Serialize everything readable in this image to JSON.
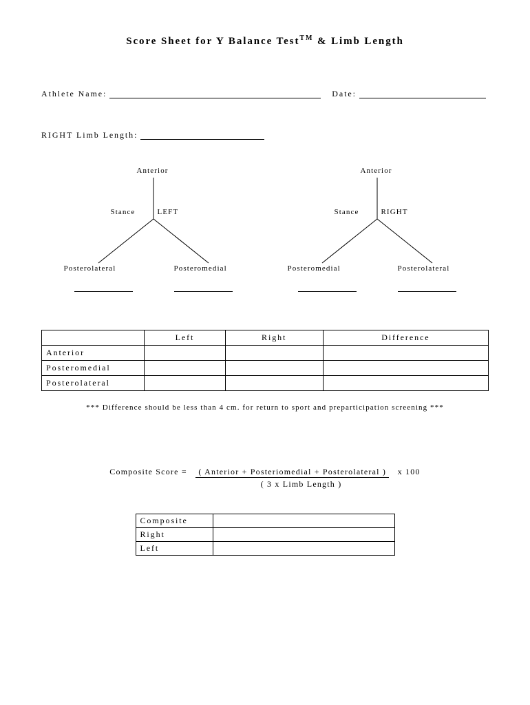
{
  "title_part1": "Score Sheet for Y Balance Test",
  "title_tm": "TM",
  "title_part2": " & Limb Length",
  "fields": {
    "athlete_name_label": "Athlete Name:",
    "date_label": "Date:",
    "limb_length_label": "RIGHT Limb Length:"
  },
  "diagram": {
    "anterior": "Anterior",
    "stance": "Stance",
    "left": "LEFT",
    "right": "RIGHT",
    "posterolateral": "Posterolateral",
    "posteromedial": "Posteromedial"
  },
  "table1": {
    "headers": [
      "",
      "Left",
      "Right",
      "Difference"
    ],
    "rows": [
      "Anterior",
      "Posteromedial",
      "Posterolateral"
    ]
  },
  "note": "*** Difference should be less than 4 cm. for return to sport and preparticipation screening ***",
  "formula": {
    "label": "Composite Score  =",
    "numerator": "( Anterior + Posteriomedial + Posterolateral )",
    "denominator": "( 3 x Limb Length )",
    "suffix": "x 100"
  },
  "comp_table": {
    "rows": [
      "Composite",
      "Right",
      "Left"
    ]
  }
}
